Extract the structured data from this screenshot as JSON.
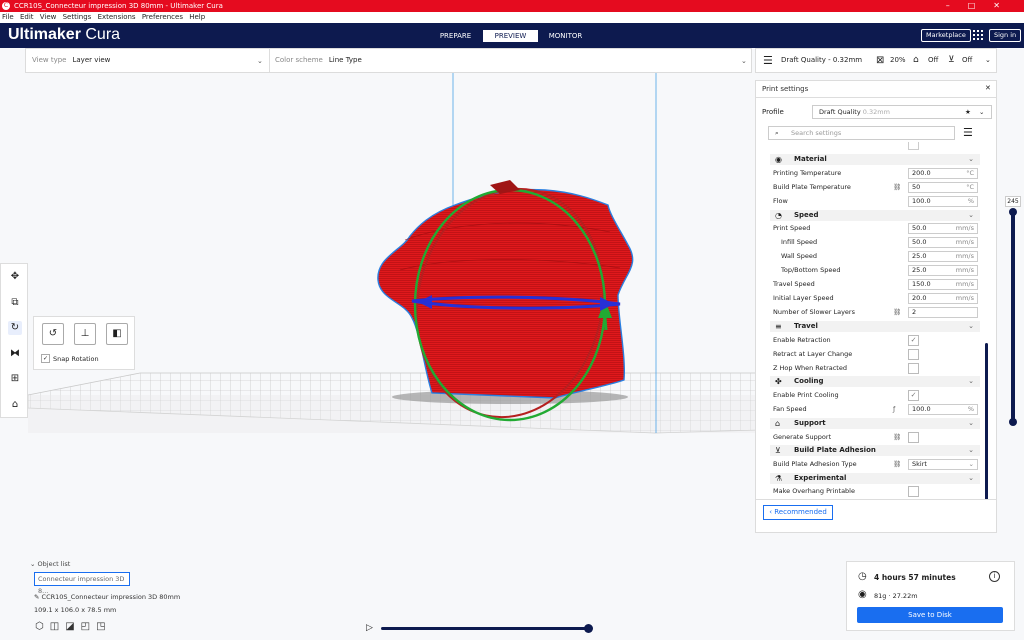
{
  "window": {
    "title": "CCR10S_Connecteur impression 3D 80mm - Ultimaker Cura"
  },
  "menu": [
    "File",
    "Edit",
    "View",
    "Settings",
    "Extensions",
    "Preferences",
    "Help"
  ],
  "brand": {
    "name": "Ultimaker",
    "product": "Cura"
  },
  "stages": [
    "PREPARE",
    "PREVIEW",
    "MONITOR"
  ],
  "header": {
    "marketplace": "Marketplace",
    "signin": "Sign in"
  },
  "viewbar": {
    "view_type_label": "View type",
    "view_type_value": "Layer view",
    "color_scheme_label": "Color scheme",
    "color_scheme_value": "Line Type"
  },
  "printbar": {
    "profile": "Draft Quality - 0.32mm",
    "infill": "20%",
    "support": "Off",
    "adhesion": "Off"
  },
  "panel": {
    "title": "Print settings",
    "profile_label": "Profile",
    "profile_value": "Draft Quality",
    "profile_hint": "0.32mm",
    "search_placeholder": "Search settings",
    "sections": {
      "material": "Material",
      "speed": "Speed",
      "travel": "Travel",
      "cooling": "Cooling",
      "support": "Support",
      "adhesion": "Build Plate Adhesion",
      "experimental": "Experimental"
    },
    "rows": {
      "print_temp": {
        "label": "Printing Temperature",
        "value": "200.0",
        "unit": "°C"
      },
      "bed_temp": {
        "label": "Build Plate Temperature",
        "value": "50",
        "unit": "°C"
      },
      "flow": {
        "label": "Flow",
        "value": "100.0",
        "unit": "%"
      },
      "print_speed": {
        "label": "Print Speed",
        "value": "50.0",
        "unit": "mm/s"
      },
      "infill_speed": {
        "label": "Infill Speed",
        "value": "50.0",
        "unit": "mm/s"
      },
      "wall_speed": {
        "label": "Wall Speed",
        "value": "25.0",
        "unit": "mm/s"
      },
      "topbottom_speed": {
        "label": "Top/Bottom Speed",
        "value": "25.0",
        "unit": "mm/s"
      },
      "travel_speed": {
        "label": "Travel Speed",
        "value": "150.0",
        "unit": "mm/s"
      },
      "initial_speed": {
        "label": "Initial Layer Speed",
        "value": "20.0",
        "unit": "mm/s"
      },
      "slower_layers": {
        "label": "Number of Slower Layers",
        "value": "2",
        "unit": ""
      },
      "retraction": {
        "label": "Enable Retraction",
        "check": "✓"
      },
      "retract_layer": {
        "label": "Retract at Layer Change",
        "check": ""
      },
      "zhop": {
        "label": "Z Hop When Retracted",
        "check": ""
      },
      "cooling_enable": {
        "label": "Enable Print Cooling",
        "check": "✓"
      },
      "fan_speed": {
        "label": "Fan Speed",
        "value": "100.0",
        "unit": "%"
      },
      "gen_support": {
        "label": "Generate Support",
        "check": ""
      },
      "adhesion_type": {
        "label": "Build Plate Adhesion Type",
        "value": "Skirt",
        "unit": ""
      },
      "overhang": {
        "label": "Make Overhang Printable",
        "check": ""
      }
    },
    "recommended": "Recommended"
  },
  "rotate": {
    "snap_label": "Snap Rotation"
  },
  "layer": {
    "current": "245"
  },
  "objects": {
    "list_label": "Object list",
    "selected": "Connecteur impression 3D 8...",
    "name": "CCR10S_Connecteur impression 3D 80mm",
    "dims": "109.1 x 106.0 x 78.5 mm"
  },
  "job": {
    "time": "4 hours 57 minutes",
    "material": "81g · 27.22m",
    "save": "Save to Disk"
  },
  "colors": {
    "accent": "#196ef0",
    "header": "#0d1a4f",
    "title": "#e50b1f",
    "model": "#d8181c"
  }
}
